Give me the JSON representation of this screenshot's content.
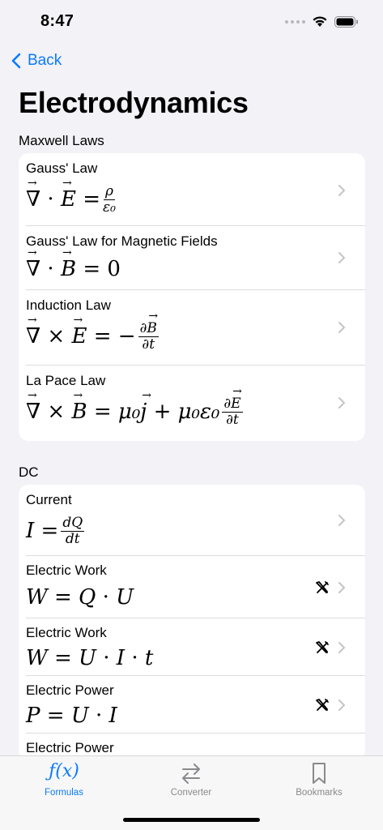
{
  "status": {
    "time": "8:47"
  },
  "nav": {
    "back_label": "Back"
  },
  "title": "Electrodynamics",
  "sections": [
    {
      "header": "Maxwell Laws",
      "rows": [
        {
          "title": "Gauss' Law",
          "formula": "∇·E = ρ/ε₀",
          "tool": false
        },
        {
          "title": "Gauss' Law for Magnetic Fields",
          "formula": "∇·B = 0",
          "tool": false
        },
        {
          "title": "Induction Law",
          "formula": "∇×E = −∂B/∂t",
          "tool": false
        },
        {
          "title": "La Pace Law",
          "formula": "∇×B = μ₀j + μ₀ε₀∂E/∂t",
          "tool": false
        }
      ]
    },
    {
      "header": "DC",
      "rows": [
        {
          "title": "Current",
          "formula": "I = dQ/dt",
          "tool": false
        },
        {
          "title": "Electric Work",
          "formula": "W = Q·U",
          "tool": true
        },
        {
          "title": "Electric Work",
          "formula": "W = U·I·t",
          "tool": true
        },
        {
          "title": "Electric Power",
          "formula": "P = U·I",
          "tool": true
        },
        {
          "title": "Electric Power",
          "formula": "",
          "tool": false
        }
      ]
    }
  ],
  "tabs": [
    {
      "label": "Formulas",
      "icon": "function-icon",
      "active": true
    },
    {
      "label": "Converter",
      "icon": "arrows-icon",
      "active": false
    },
    {
      "label": "Bookmarks",
      "icon": "bookmark-icon",
      "active": false
    }
  ],
  "colors": {
    "accent": "#0a7aff",
    "inactive": "#8a8a8e",
    "background": "#f2f2f7"
  }
}
